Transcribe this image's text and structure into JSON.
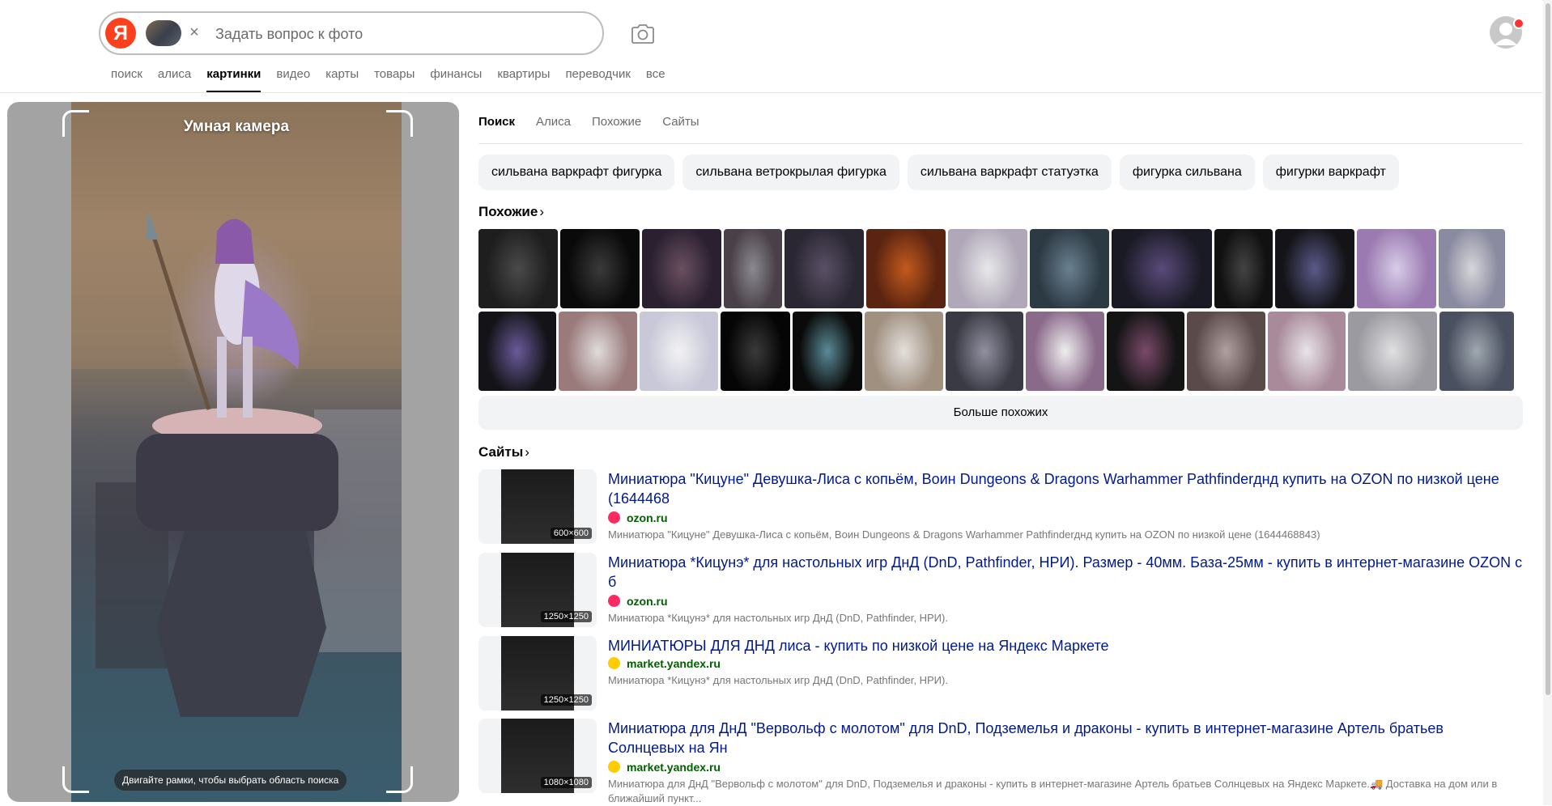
{
  "header": {
    "logo_text": "Я",
    "search": {
      "placeholder": "Задать вопрос к фото",
      "value": ""
    },
    "clear_glyph": "×",
    "nav": [
      "поиск",
      "алиса",
      "картинки",
      "видео",
      "карты",
      "товары",
      "финансы",
      "квартиры",
      "переводчик",
      "все"
    ],
    "nav_active": "картинки"
  },
  "camera": {
    "title": "Умная камера",
    "hint": "Двигайте рамки, чтобы выбрать область поиска"
  },
  "results": {
    "tabs": [
      "Поиск",
      "Алиса",
      "Похожие",
      "Сайты"
    ],
    "active_tab": "Поиск",
    "chips": [
      "сильвана варкрафт фигурка",
      "сильвана ветрокрылая фигурка",
      "сильвана варкрафт статуэтка",
      "фигурка сильвана",
      "фигурки варкрафт"
    ],
    "similar_title": "Похожие",
    "similar_more": "Больше похожих",
    "similar_rows": [
      [
        {
          "w": 98,
          "c1": "#4a4a4a",
          "c2": "#1e1e1e"
        },
        {
          "w": 98,
          "c1": "#3a3a3a",
          "c2": "#0a0a0a"
        },
        {
          "w": 98,
          "c1": "#6a5060",
          "c2": "#2a2030"
        },
        {
          "w": 72,
          "c1": "#8a8a90",
          "c2": "#4a4048"
        },
        {
          "w": 98,
          "c1": "#5a5066",
          "c2": "#2a2632"
        },
        {
          "w": 98,
          "c1": "#c35a1e",
          "c2": "#5a2410"
        },
        {
          "w": 98,
          "c1": "#e8e8ea",
          "c2": "#b0a8b8"
        },
        {
          "w": 98,
          "c1": "#6a8090",
          "c2": "#2c3a44"
        },
        {
          "w": 124,
          "c1": "#5a4a7a",
          "c2": "#1a1a24"
        },
        {
          "w": 72,
          "c1": "#444",
          "c2": "#111"
        },
        {
          "w": 98,
          "c1": "#5a5a8a",
          "c2": "#141418"
        },
        {
          "w": 98,
          "c1": "#d8cce8",
          "c2": "#9a7ab0"
        },
        {
          "w": 82,
          "c1": "#d6d6da",
          "c2": "#8a8aa0"
        }
      ],
      [
        {
          "w": 96,
          "c1": "#6a5a9a",
          "c2": "#141418"
        },
        {
          "w": 97,
          "c1": "#e0dcdc",
          "c2": "#9a7a7a"
        },
        {
          "w": 97,
          "c1": "#f2f2f4",
          "c2": "#c8c8d8"
        },
        {
          "w": 86,
          "c1": "#3a3a3a",
          "c2": "#050505"
        },
        {
          "w": 86,
          "c1": "#5a8a96",
          "c2": "#0a0a0a"
        },
        {
          "w": 97,
          "c1": "#e4e0dc",
          "c2": "#a09080"
        },
        {
          "w": 96,
          "c1": "#9090a0",
          "c2": "#3a3a44"
        },
        {
          "w": 97,
          "c1": "#eeeeee",
          "c2": "#8a6a8a"
        },
        {
          "w": 96,
          "c1": "#7a4a6a",
          "c2": "#141414"
        },
        {
          "w": 97,
          "c1": "#b0a0a0",
          "c2": "#5a4a4a"
        },
        {
          "w": 96,
          "c1": "#e8e4e8",
          "c2": "#a88a9a"
        },
        {
          "w": 110,
          "c1": "#e0e0e2",
          "c2": "#9a9aa0"
        },
        {
          "w": 92,
          "c1": "#a0a8b0",
          "c2": "#4a5060"
        }
      ]
    ],
    "sites_title": "Сайты",
    "sites": [
      {
        "title": "Миниатюра \"Кицуне\" Девушка-Лиса с копьём, Воин Dungeons & Dragons Warhammer Pathfinderднд купить на OZON по низкой цене (1644468",
        "domain": "ozon.ru",
        "fav_color": "#ff2a62",
        "desc": "Миниатюра \"Кицуне\" Девушка-Лиса с копьём, Воин Dungeons & Dragons Warhammer Pathfinderднд купить на OZON по низкой цене (1644468843)",
        "size": "600×600"
      },
      {
        "title": "Миниатюра *Кицунэ* для настольных игр ДнД (DnD, Pathfinder, НРИ). Размер - 40мм. База-25мм - купить в интернет-магазине OZON с б",
        "domain": "ozon.ru",
        "fav_color": "#ff2a62",
        "desc": "Миниатюра *Кицунэ* для настольных игр ДнД (DnD, Pathfinder, НРИ).",
        "size": "1250×1250"
      },
      {
        "title": "МИНИАТЮРЫ ДЛЯ ДНД лиса - купить по низкой цене на Яндекс Маркете",
        "domain": "market.yandex.ru",
        "fav_color": "#ffcc00",
        "desc": "Миниатюра *Кицунэ* для настольных игр ДнД (DnD, Pathfinder, НРИ).",
        "size": "1250×1250"
      },
      {
        "title": "Миниатюра для ДнД \"Вервольф с молотом\" для DnD, Подземелья и драконы - купить в интернет-магазине Артель братьев Солнцевых на Ян",
        "domain": "market.yandex.ru",
        "fav_color": "#ffcc00",
        "desc": "Миниатюра для ДнД \"Вервольф с молотом\" для DnD, Подземелья и драконы - купить в интернет-магазине Артель братьев Солнцевых на Яндекс Маркете.🚚 Доставка на дом или в ближайший пункт...",
        "size": "1080×1080"
      }
    ]
  }
}
